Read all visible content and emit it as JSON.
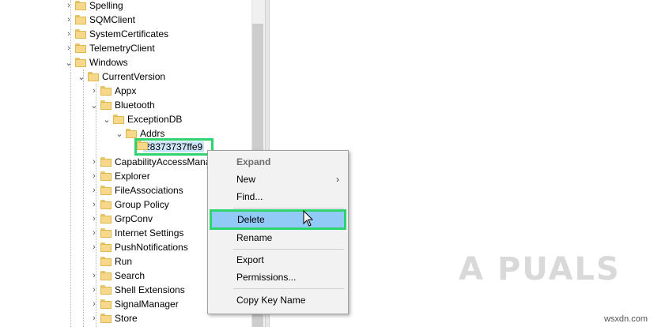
{
  "tree": {
    "nodes": [
      {
        "label": "Spelling",
        "level": 0,
        "expander": "right"
      },
      {
        "label": "SQMClient",
        "level": 0,
        "expander": "right"
      },
      {
        "label": "SystemCertificates",
        "level": 0,
        "expander": "right"
      },
      {
        "label": "TelemetryClient",
        "level": 0,
        "expander": "right"
      },
      {
        "label": "Windows",
        "level": 0,
        "expander": "down"
      },
      {
        "label": "CurrentVersion",
        "level": 1,
        "expander": "down"
      },
      {
        "label": "Appx",
        "level": 2,
        "expander": "right"
      },
      {
        "label": "Bluetooth",
        "level": 2,
        "expander": "down"
      },
      {
        "label": "ExceptionDB",
        "level": 3,
        "expander": "down"
      },
      {
        "label": "Addrs",
        "level": 4,
        "expander": "down"
      },
      {
        "label": "28373737ffe9",
        "level": 5,
        "expander": "none"
      },
      {
        "label": "CapabilityAccessMana",
        "level": 2,
        "expander": "right"
      },
      {
        "label": "Explorer",
        "level": 2,
        "expander": "right"
      },
      {
        "label": "FileAssociations",
        "level": 2,
        "expander": "right"
      },
      {
        "label": "Group Policy",
        "level": 2,
        "expander": "right"
      },
      {
        "label": "GrpConv",
        "level": 2,
        "expander": "right"
      },
      {
        "label": "Internet Settings",
        "level": 2,
        "expander": "right"
      },
      {
        "label": "PushNotifications",
        "level": 2,
        "expander": "right"
      },
      {
        "label": "Run",
        "level": 2,
        "expander": "none"
      },
      {
        "label": "Search",
        "level": 2,
        "expander": "right"
      },
      {
        "label": "Shell Extensions",
        "level": 2,
        "expander": "right"
      },
      {
        "label": "SignalManager",
        "level": 2,
        "expander": "right"
      },
      {
        "label": "Store",
        "level": 2,
        "expander": "right"
      }
    ]
  },
  "context_menu": {
    "expand": "Expand",
    "new": "New",
    "find": "Find...",
    "delete": "Delete",
    "rename": "Rename",
    "export": "Export",
    "permissions": "Permissions...",
    "copy_key_name": "Copy Key Name",
    "submenu_arrow": "›"
  },
  "watermark": {
    "brand": "A PUALS",
    "site": "wsxdn.com"
  },
  "colors": {
    "highlight_border": "#2fd36f",
    "menu_hover": "#91c9f7",
    "folder": "#f7d88a"
  }
}
